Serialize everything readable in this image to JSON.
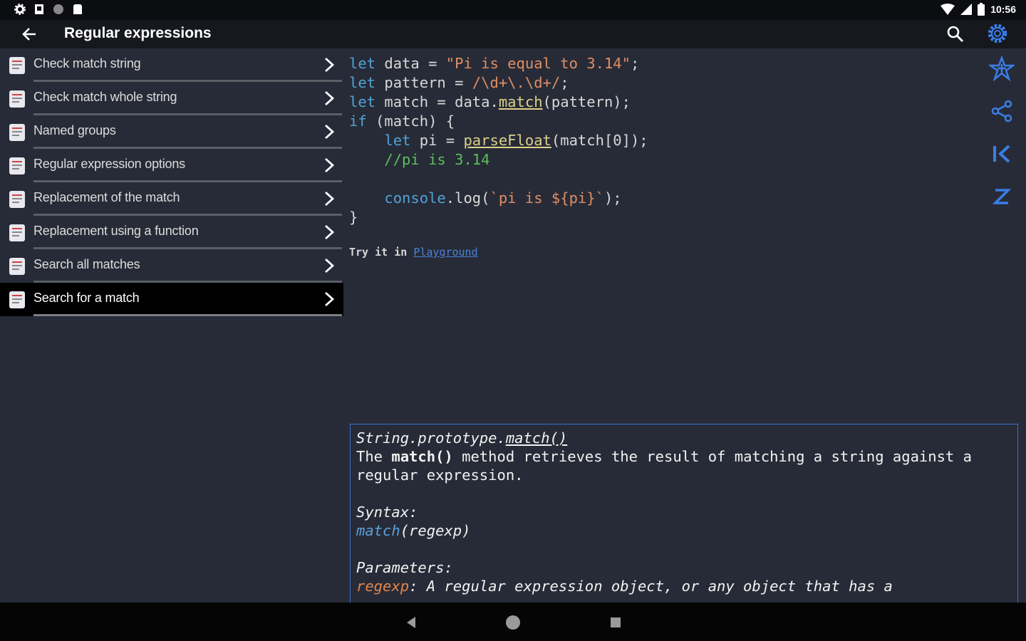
{
  "status_bar": {
    "time": "10:56"
  },
  "app_bar": {
    "title": "Regular expressions"
  },
  "sidebar": {
    "items": [
      {
        "label": "Check match string"
      },
      {
        "label": "Check match whole string"
      },
      {
        "label": "Named groups"
      },
      {
        "label": "Regular expression options"
      },
      {
        "label": "Replacement of the match"
      },
      {
        "label": "Replacement using a function"
      },
      {
        "label": "Search all matches"
      },
      {
        "label": "Search for a match",
        "selected": true
      }
    ]
  },
  "code": {
    "line1": {
      "kw": "let",
      "name": " data = ",
      "str": "\"Pi is equal to 3.14\"",
      "end": ";"
    },
    "line2": {
      "kw": "let",
      "name": " pattern = ",
      "str": "/\\d+\\.\\d+/",
      "end": ";"
    },
    "line3": {
      "kw": "let",
      "name": " match = data.",
      "fn": "match",
      "end": "(pattern);"
    },
    "line4": {
      "kw": "if",
      "rest": " (match) {"
    },
    "line5": {
      "kw": "let",
      "name": " pi = ",
      "fn": "parseFloat",
      "end": "(match[0]);"
    },
    "line6": {
      "comment": "//pi is 3.14"
    },
    "line7": {
      "obj": "console",
      "call": ".log(",
      "tpl": "`pi is ${pi}`",
      "end": ");"
    },
    "line8": {
      "text": "}"
    }
  },
  "try_link": {
    "prefix": "Try it in ",
    "link": "Playground"
  },
  "doc": {
    "signature_obj": "String.prototype.",
    "signature_method": "match()",
    "intro_pre": "The ",
    "intro_bold": "match()",
    "intro_post": " method retrieves the result of matching a string against a regular expression.",
    "syntax_label": "Syntax:",
    "syntax_fn": "match",
    "syntax_args": "(regexp)",
    "params_label": "Parameters:",
    "param_name": "regexp",
    "param_desc": ": A regular expression object, or any object that has a"
  },
  "icons": {
    "back": "arrow-back-icon",
    "search": "search-icon",
    "settings": "gear-icon",
    "favorite": "star-icon",
    "share": "share-icon",
    "first": "first-page-icon",
    "sleep": "z-icon"
  },
  "colors": {
    "accent": "#3a7ee8",
    "keyword": "#4fa3d8",
    "string": "#e08e63",
    "comment": "#5cbf5c"
  }
}
